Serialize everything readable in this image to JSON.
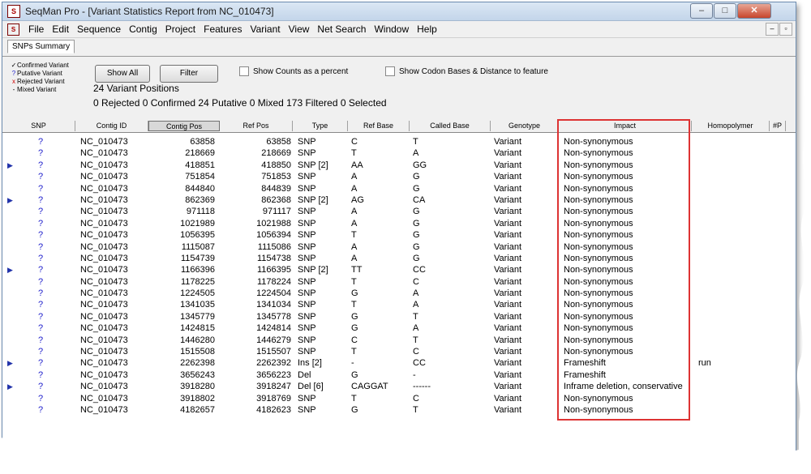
{
  "window": {
    "title": "SeqMan Pro - [Variant Statistics Report from NC_010473]",
    "app_icon_text": "S",
    "buttons": {
      "minimize": "–",
      "maximize": "□",
      "close": "✕"
    }
  },
  "menu": {
    "items": [
      "File",
      "Edit",
      "Sequence",
      "Contig",
      "Project",
      "Features",
      "Variant",
      "View",
      "Net Search",
      "Window",
      "Help"
    ],
    "mdi_buttons": {
      "minimize": "–",
      "restore": "▫"
    }
  },
  "tab": {
    "label": "SNPs Summary"
  },
  "legend": {
    "items": [
      {
        "mark": "✓",
        "label": "Confirmed Variant",
        "color": "#000000"
      },
      {
        "mark": "?",
        "label": "Putative Variant",
        "color": "#2222cc"
      },
      {
        "mark": "x",
        "label": "Rejected Variant",
        "color": "#cc0000"
      },
      {
        "mark": "-",
        "label": "Mixed Variant",
        "color": "#000000"
      }
    ]
  },
  "controls": {
    "show_all": "Show All",
    "filter": "Filter",
    "show_counts_percent": "Show Counts as a percent",
    "show_codon_bases": "Show Codon Bases & Distance to feature",
    "variant_positions": "24 Variant Positions",
    "summary": "0 Rejected  0 Confirmed  24 Putative  0 Mixed  173 Filtered  0 Selected"
  },
  "table": {
    "headers": [
      "SNP",
      "Contig ID",
      "Contig Pos",
      "Ref Pos",
      "Type",
      "Ref Base",
      "Called Base",
      "Genotype",
      "Impact",
      "Homopolymer",
      "#P"
    ],
    "rows": [
      {
        "marker": false,
        "snp": "?",
        "contig_id": "NC_010473",
        "contig_pos": "63858",
        "ref_pos": "63858",
        "type": "SNP",
        "ref_base": "C",
        "called_base": "T",
        "genotype": "Variant",
        "impact": "Non-synonymous",
        "homopolymer": ""
      },
      {
        "marker": false,
        "snp": "?",
        "contig_id": "NC_010473",
        "contig_pos": "218669",
        "ref_pos": "218669",
        "type": "SNP",
        "ref_base": "T",
        "called_base": "A",
        "genotype": "Variant",
        "impact": "Non-synonymous",
        "homopolymer": ""
      },
      {
        "marker": true,
        "snp": "?",
        "contig_id": "NC_010473",
        "contig_pos": "418851",
        "ref_pos": "418850",
        "type": "SNP  [2]",
        "ref_base": "AA",
        "called_base": "GG",
        "genotype": "Variant",
        "impact": "Non-synonymous",
        "homopolymer": ""
      },
      {
        "marker": false,
        "snp": "?",
        "contig_id": "NC_010473",
        "contig_pos": "751854",
        "ref_pos": "751853",
        "type": "SNP",
        "ref_base": "A",
        "called_base": "G",
        "genotype": "Variant",
        "impact": "Non-synonymous",
        "homopolymer": ""
      },
      {
        "marker": false,
        "snp": "?",
        "contig_id": "NC_010473",
        "contig_pos": "844840",
        "ref_pos": "844839",
        "type": "SNP",
        "ref_base": "A",
        "called_base": "G",
        "genotype": "Variant",
        "impact": "Non-synonymous",
        "homopolymer": ""
      },
      {
        "marker": true,
        "snp": "?",
        "contig_id": "NC_010473",
        "contig_pos": "862369",
        "ref_pos": "862368",
        "type": "SNP  [2]",
        "ref_base": "AG",
        "called_base": "CA",
        "genotype": "Variant",
        "impact": "Non-synonymous",
        "homopolymer": ""
      },
      {
        "marker": false,
        "snp": "?",
        "contig_id": "NC_010473",
        "contig_pos": "971118",
        "ref_pos": "971117",
        "type": "SNP",
        "ref_base": "A",
        "called_base": "G",
        "genotype": "Variant",
        "impact": "Non-synonymous",
        "homopolymer": ""
      },
      {
        "marker": false,
        "snp": "?",
        "contig_id": "NC_010473",
        "contig_pos": "1021989",
        "ref_pos": "1021988",
        "type": "SNP",
        "ref_base": "A",
        "called_base": "G",
        "genotype": "Variant",
        "impact": "Non-synonymous",
        "homopolymer": ""
      },
      {
        "marker": false,
        "snp": "?",
        "contig_id": "NC_010473",
        "contig_pos": "1056395",
        "ref_pos": "1056394",
        "type": "SNP",
        "ref_base": "T",
        "called_base": "G",
        "genotype": "Variant",
        "impact": "Non-synonymous",
        "homopolymer": ""
      },
      {
        "marker": false,
        "snp": "?",
        "contig_id": "NC_010473",
        "contig_pos": "1115087",
        "ref_pos": "1115086",
        "type": "SNP",
        "ref_base": "A",
        "called_base": "G",
        "genotype": "Variant",
        "impact": "Non-synonymous",
        "homopolymer": ""
      },
      {
        "marker": false,
        "snp": "?",
        "contig_id": "NC_010473",
        "contig_pos": "1154739",
        "ref_pos": "1154738",
        "type": "SNP",
        "ref_base": "A",
        "called_base": "G",
        "genotype": "Variant",
        "impact": "Non-synonymous",
        "homopolymer": ""
      },
      {
        "marker": true,
        "snp": "?",
        "contig_id": "NC_010473",
        "contig_pos": "1166396",
        "ref_pos": "1166395",
        "type": "SNP  [2]",
        "ref_base": "TT",
        "called_base": "CC",
        "genotype": "Variant",
        "impact": "Non-synonymous",
        "homopolymer": ""
      },
      {
        "marker": false,
        "snp": "?",
        "contig_id": "NC_010473",
        "contig_pos": "1178225",
        "ref_pos": "1178224",
        "type": "SNP",
        "ref_base": "T",
        "called_base": "C",
        "genotype": "Variant",
        "impact": "Non-synonymous",
        "homopolymer": ""
      },
      {
        "marker": false,
        "snp": "?",
        "contig_id": "NC_010473",
        "contig_pos": "1224505",
        "ref_pos": "1224504",
        "type": "SNP",
        "ref_base": "G",
        "called_base": "A",
        "genotype": "Variant",
        "impact": "Non-synonymous",
        "homopolymer": ""
      },
      {
        "marker": false,
        "snp": "?",
        "contig_id": "NC_010473",
        "contig_pos": "1341035",
        "ref_pos": "1341034",
        "type": "SNP",
        "ref_base": "T",
        "called_base": "A",
        "genotype": "Variant",
        "impact": "Non-synonymous",
        "homopolymer": ""
      },
      {
        "marker": false,
        "snp": "?",
        "contig_id": "NC_010473",
        "contig_pos": "1345779",
        "ref_pos": "1345778",
        "type": "SNP",
        "ref_base": "G",
        "called_base": "T",
        "genotype": "Variant",
        "impact": "Non-synonymous",
        "homopolymer": ""
      },
      {
        "marker": false,
        "snp": "?",
        "contig_id": "NC_010473",
        "contig_pos": "1424815",
        "ref_pos": "1424814",
        "type": "SNP",
        "ref_base": "G",
        "called_base": "A",
        "genotype": "Variant",
        "impact": "Non-synonymous",
        "homopolymer": ""
      },
      {
        "marker": false,
        "snp": "?",
        "contig_id": "NC_010473",
        "contig_pos": "1446280",
        "ref_pos": "1446279",
        "type": "SNP",
        "ref_base": "C",
        "called_base": "T",
        "genotype": "Variant",
        "impact": "Non-synonymous",
        "homopolymer": ""
      },
      {
        "marker": false,
        "snp": "?",
        "contig_id": "NC_010473",
        "contig_pos": "1515508",
        "ref_pos": "1515507",
        "type": "SNP",
        "ref_base": "T",
        "called_base": "C",
        "genotype": "Variant",
        "impact": "Non-synonymous",
        "homopolymer": ""
      },
      {
        "marker": true,
        "snp": "?",
        "contig_id": "NC_010473",
        "contig_pos": "2262398",
        "ref_pos": "2262392",
        "type": "Ins  [2]",
        "ref_base": "-",
        "called_base": "CC",
        "genotype": "Variant",
        "impact": "Frameshift",
        "homopolymer": "run"
      },
      {
        "marker": false,
        "snp": "?",
        "contig_id": "NC_010473",
        "contig_pos": "3656243",
        "ref_pos": "3656223",
        "type": "Del",
        "ref_base": "G",
        "called_base": "-",
        "genotype": "Variant",
        "impact": "Frameshift",
        "homopolymer": ""
      },
      {
        "marker": true,
        "snp": "?",
        "contig_id": "NC_010473",
        "contig_pos": "3918280",
        "ref_pos": "3918247",
        "type": "Del  [6]",
        "ref_base": "CAGGAT",
        "called_base": "------",
        "genotype": "Variant",
        "impact": "Inframe deletion, conservative",
        "homopolymer": ""
      },
      {
        "marker": false,
        "snp": "?",
        "contig_id": "NC_010473",
        "contig_pos": "3918802",
        "ref_pos": "3918769",
        "type": "SNP",
        "ref_base": "T",
        "called_base": "C",
        "genotype": "Variant",
        "impact": "Non-synonymous",
        "homopolymer": ""
      },
      {
        "marker": false,
        "snp": "?",
        "contig_id": "NC_010473",
        "contig_pos": "4182657",
        "ref_pos": "4182623",
        "type": "SNP",
        "ref_base": "G",
        "called_base": "T",
        "genotype": "Variant",
        "impact": "Non-synonymous",
        "homopolymer": ""
      }
    ]
  },
  "colors": {
    "highlight": "#dd3333",
    "putative": "#2222cc",
    "marker": "#2233aa"
  }
}
